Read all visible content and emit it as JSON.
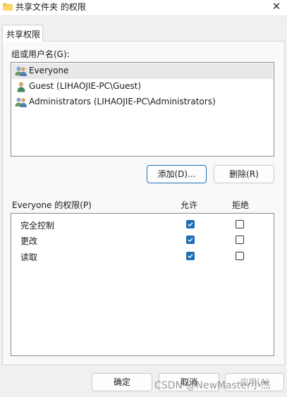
{
  "window": {
    "title": "共享文件夹 的权限",
    "close_glyph": "✕"
  },
  "tab": {
    "label": "共享权限"
  },
  "groups": {
    "label": "组或用户名(G):",
    "users": [
      {
        "name": "Everyone",
        "icon": "group-users-icon",
        "selected": true
      },
      {
        "name": "Guest (LIHAOJIE-PC\\Guest)",
        "icon": "single-user-icon",
        "selected": false
      },
      {
        "name": "Administrators (LIHAOJIE-PC\\Administrators)",
        "icon": "group-users-icon",
        "selected": false
      }
    ]
  },
  "buttons": {
    "add": "添加(D)...",
    "remove": "删除(R)"
  },
  "permissions": {
    "label": "Everyone 的权限(P)",
    "allow_header": "允许",
    "deny_header": "拒绝",
    "rows": [
      {
        "name": "完全控制",
        "allow": true,
        "deny": false
      },
      {
        "name": "更改",
        "allow": true,
        "deny": false
      },
      {
        "name": "读取",
        "allow": true,
        "deny": false
      }
    ]
  },
  "footer": {
    "ok": "确定",
    "cancel": "取消",
    "apply": "应用(A)"
  },
  "watermark": "CSDN @NewMaster小杰",
  "colors": {
    "accent": "#1f6fb5",
    "selection": "#e8e8e8"
  }
}
